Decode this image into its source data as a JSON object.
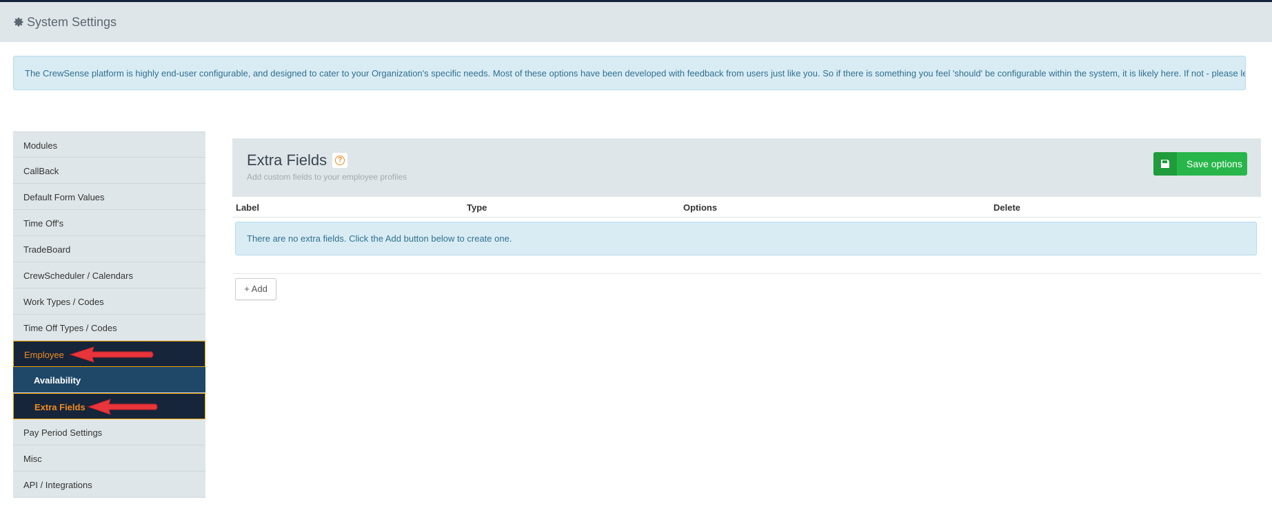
{
  "header": {
    "title": "System Settings",
    "icon": "gear-icon"
  },
  "info_banner": {
    "text": "The CrewSense platform is highly end-user configurable, and designed to cater to your Organization's specific needs. Most of these options have been developed with feedback from users just like you. So if there is something you feel 'should' be configurable within the system, it is likely here. If not - please let us know!"
  },
  "sidebar": {
    "items": [
      {
        "label": "Modules"
      },
      {
        "label": "CallBack"
      },
      {
        "label": "Default Form Values"
      },
      {
        "label": "Time Off's"
      },
      {
        "label": "TradeBoard"
      },
      {
        "label": "CrewScheduler / Calendars"
      },
      {
        "label": "Work Types / Codes"
      },
      {
        "label": "Time Off Types / Codes"
      },
      {
        "label": "Employee"
      },
      {
        "label": "Availability"
      },
      {
        "label": "Extra Fields"
      },
      {
        "label": "Pay Period Settings"
      },
      {
        "label": "Misc"
      },
      {
        "label": "API / Integrations"
      }
    ]
  },
  "panel": {
    "title": "Extra Fields",
    "subtitle": "Add custom fields to your employee profiles",
    "save_label": "Save options"
  },
  "table": {
    "columns": [
      "Label",
      "Type",
      "Options",
      "Delete"
    ],
    "empty_message": "There are no extra fields. Click the Add button below to create one."
  },
  "add_label": "+ Add",
  "colors": {
    "accent": "#f18a21",
    "navy": "#16253a",
    "sub_nav": "#1f4868",
    "success": "#28b64a",
    "arrow": "#e8353b"
  }
}
